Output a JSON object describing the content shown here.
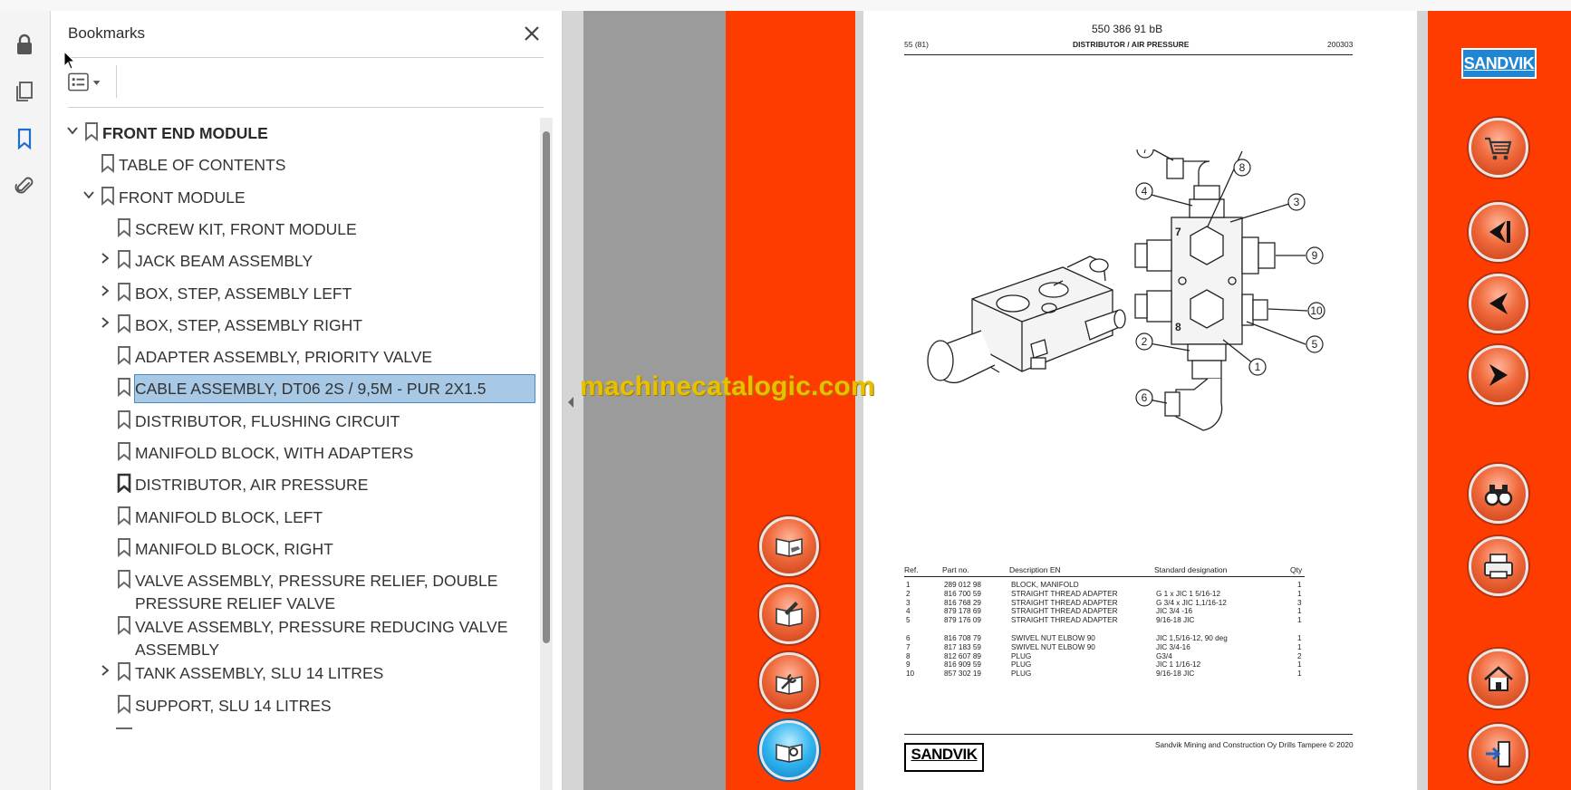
{
  "rail": {
    "icons": [
      "lock-icon",
      "pages-icon",
      "bookmark-icon",
      "attachment-icon"
    ],
    "active": "bookmark-icon"
  },
  "bookmarks": {
    "title": "Bookmarks",
    "items": [
      {
        "label": "FRONT END MODULE",
        "level": 0,
        "expand": "expanded",
        "bold": true
      },
      {
        "label": "TABLE OF CONTENTS",
        "level": 1,
        "expand": "none"
      },
      {
        "label": "FRONT MODULE",
        "level": 1,
        "expand": "expanded"
      },
      {
        "label": "SCREW KIT, FRONT MODULE",
        "level": 2,
        "expand": "none"
      },
      {
        "label": "JACK BEAM ASSEMBLY",
        "level": 2,
        "expand": "collapsed"
      },
      {
        "label": "BOX, STEP, ASSEMBLY LEFT",
        "level": 2,
        "expand": "collapsed"
      },
      {
        "label": "BOX, STEP, ASSEMBLY RIGHT",
        "level": 2,
        "expand": "collapsed"
      },
      {
        "label": "ADAPTER ASSEMBLY, PRIORITY VALVE",
        "level": 2,
        "expand": "none"
      },
      {
        "label": "CABLE ASSEMBLY, DT06 2S / 9,5M - PUR 2X1.5",
        "level": 2,
        "expand": "none",
        "selected": true
      },
      {
        "label": "DISTRIBUTOR, FLUSHING CIRCUIT",
        "level": 2,
        "expand": "none"
      },
      {
        "label": "MANIFOLD BLOCK, WITH ADAPTERS",
        "level": 2,
        "expand": "none"
      },
      {
        "label": "DISTRIBUTOR, AIR PRESSURE",
        "level": 2,
        "expand": "none",
        "current": true
      },
      {
        "label": "MANIFOLD BLOCK, LEFT",
        "level": 2,
        "expand": "none"
      },
      {
        "label": "MANIFOLD BLOCK, RIGHT",
        "level": 2,
        "expand": "none"
      },
      {
        "label": "VALVE ASSEMBLY, PRESSURE RELIEF, DOUBLE PRESSURE RELIEF VALVE",
        "level": 2,
        "expand": "none",
        "lines": 2
      },
      {
        "label": "VALVE ASSEMBLY, PRESSURE REDUCING VALVE ASSEMBLY",
        "level": 2,
        "expand": "none",
        "lines": 2
      },
      {
        "label": "TANK ASSEMBLY, SLU 14 LITRES",
        "level": 2,
        "expand": "collapsed"
      },
      {
        "label": "SUPPORT, SLU 14 LITRES",
        "level": 2,
        "expand": "none"
      }
    ]
  },
  "viewer": {
    "watermark": "machinecatalogic.com",
    "left_buttons": [
      "book-hand-icon",
      "book-edit-icon",
      "book-wrench-icon",
      "book-search-icon"
    ],
    "right_buttons": [
      "cart-icon",
      "first-page-icon",
      "prev-page-icon",
      "next-page-icon",
      "binoculars-icon",
      "printer-icon",
      "home-icon",
      "exit-icon"
    ],
    "brand": "SANDVIK"
  },
  "document": {
    "doc_number": "550 386 91 bB",
    "page_ref": "55 (81)",
    "title": "DISTRIBUTOR / AIR PRESSURE",
    "date_code": "200303",
    "table": {
      "headers": [
        "Ref.",
        "Part no.",
        "Description EN",
        "Standard designation",
        "Qty"
      ],
      "rows": [
        [
          "1",
          "289 012 98",
          "BLOCK, MANIFOLD",
          "",
          "1"
        ],
        [
          "2",
          "816 700 59",
          "STRAIGHT THREAD ADAPTER",
          "G 1 x JIC 1 5/16-12",
          "1"
        ],
        [
          "3",
          "816 768 29",
          "STRAIGHT THREAD ADAPTER",
          "G 3/4 x JIC 1,1/16-12",
          "3"
        ],
        [
          "4",
          "879 178 69",
          "STRAIGHT THREAD ADAPTER",
          "JIC 3/4 -16",
          "1"
        ],
        [
          "5",
          "879 176 09",
          "STRAIGHT THREAD ADAPTER",
          "9/16-18 JIC",
          "1"
        ],
        [
          "6",
          "816 708 79",
          "SWIVEL NUT ELBOW 90",
          "JIC 1,5/16-12, 90 deg",
          "1"
        ],
        [
          "7",
          "817 183 59",
          "SWIVEL NUT ELBOW 90",
          "JIC 3/4-16",
          "1"
        ],
        [
          "8",
          "812 607 89",
          "PLUG",
          "G3/4",
          "2"
        ],
        [
          "9",
          "816 909 59",
          "PLUG",
          "JIC 1 1/16-12",
          "1"
        ],
        [
          "10",
          "857 302 19",
          "PLUG",
          "9/16-18 JIC",
          "1"
        ]
      ]
    },
    "footer": "Sandvik Mining and Construction Oy Drills Tampere © 2020",
    "footer_logo": "SANDVIK",
    "callouts": [
      "7",
      "8",
      "4",
      "3",
      "9",
      "10",
      "5",
      "2",
      "1",
      "6"
    ],
    "block_marks": [
      "7",
      "8"
    ]
  }
}
